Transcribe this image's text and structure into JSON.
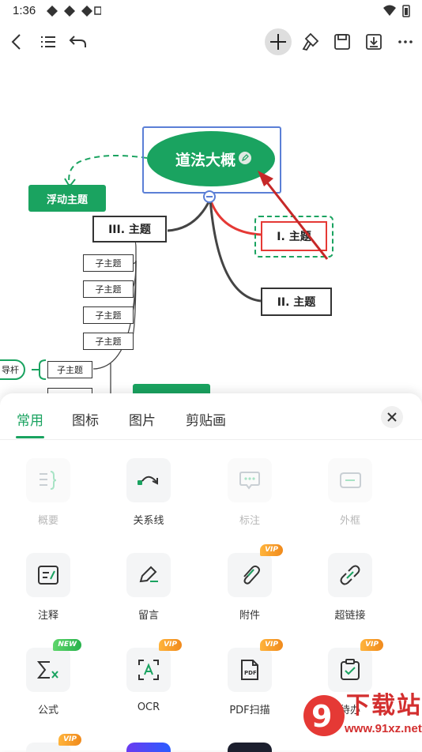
{
  "status": {
    "time": "1:36"
  },
  "toolbar": {
    "icons": [
      "back-icon",
      "outline-icon",
      "undo-icon",
      "add-icon",
      "format-paint-icon",
      "save-icon",
      "export-icon",
      "more-icon"
    ]
  },
  "mindmap": {
    "central": "道法大概",
    "floating": "浮动主题",
    "topic3": "III. 主题",
    "topic1": "I. 主题",
    "topic2": "II. 主题",
    "sub_label": "子主题",
    "left_partial": "导杆"
  },
  "panel": {
    "tabs": [
      "常用",
      "图标",
      "图片",
      "剪贴画"
    ],
    "active_tab": "常用",
    "tools": [
      {
        "label": "概要",
        "icon": "summary-icon",
        "disabled": true,
        "badge": ""
      },
      {
        "label": "关系线",
        "icon": "relation-line-icon",
        "disabled": false,
        "badge": ""
      },
      {
        "label": "标注",
        "icon": "callout-icon",
        "disabled": true,
        "badge": ""
      },
      {
        "label": "外框",
        "icon": "boundary-icon",
        "disabled": true,
        "badge": ""
      },
      {
        "label": "注释",
        "icon": "note-icon",
        "disabled": false,
        "badge": ""
      },
      {
        "label": "留言",
        "icon": "comment-icon",
        "disabled": false,
        "badge": ""
      },
      {
        "label": "附件",
        "icon": "attachment-icon",
        "disabled": false,
        "badge": "VIP"
      },
      {
        "label": "超链接",
        "icon": "hyperlink-icon",
        "disabled": false,
        "badge": ""
      },
      {
        "label": "公式",
        "icon": "formula-icon",
        "disabled": false,
        "badge": "NEW"
      },
      {
        "label": "OCR",
        "icon": "ocr-icon",
        "disabled": false,
        "badge": "VIP"
      },
      {
        "label": "PDF扫描",
        "icon": "pdf-scan-icon",
        "disabled": false,
        "badge": "VIP"
      },
      {
        "label": "待办",
        "icon": "todo-icon",
        "disabled": false,
        "badge": "VIP"
      }
    ],
    "row4_badge": "VIP"
  },
  "watermark": {
    "text": "下载站",
    "url": "www.91xz.net"
  },
  "colors": {
    "accent": "#1aa360",
    "red": "#e53935",
    "select": "#5b7fd6"
  }
}
